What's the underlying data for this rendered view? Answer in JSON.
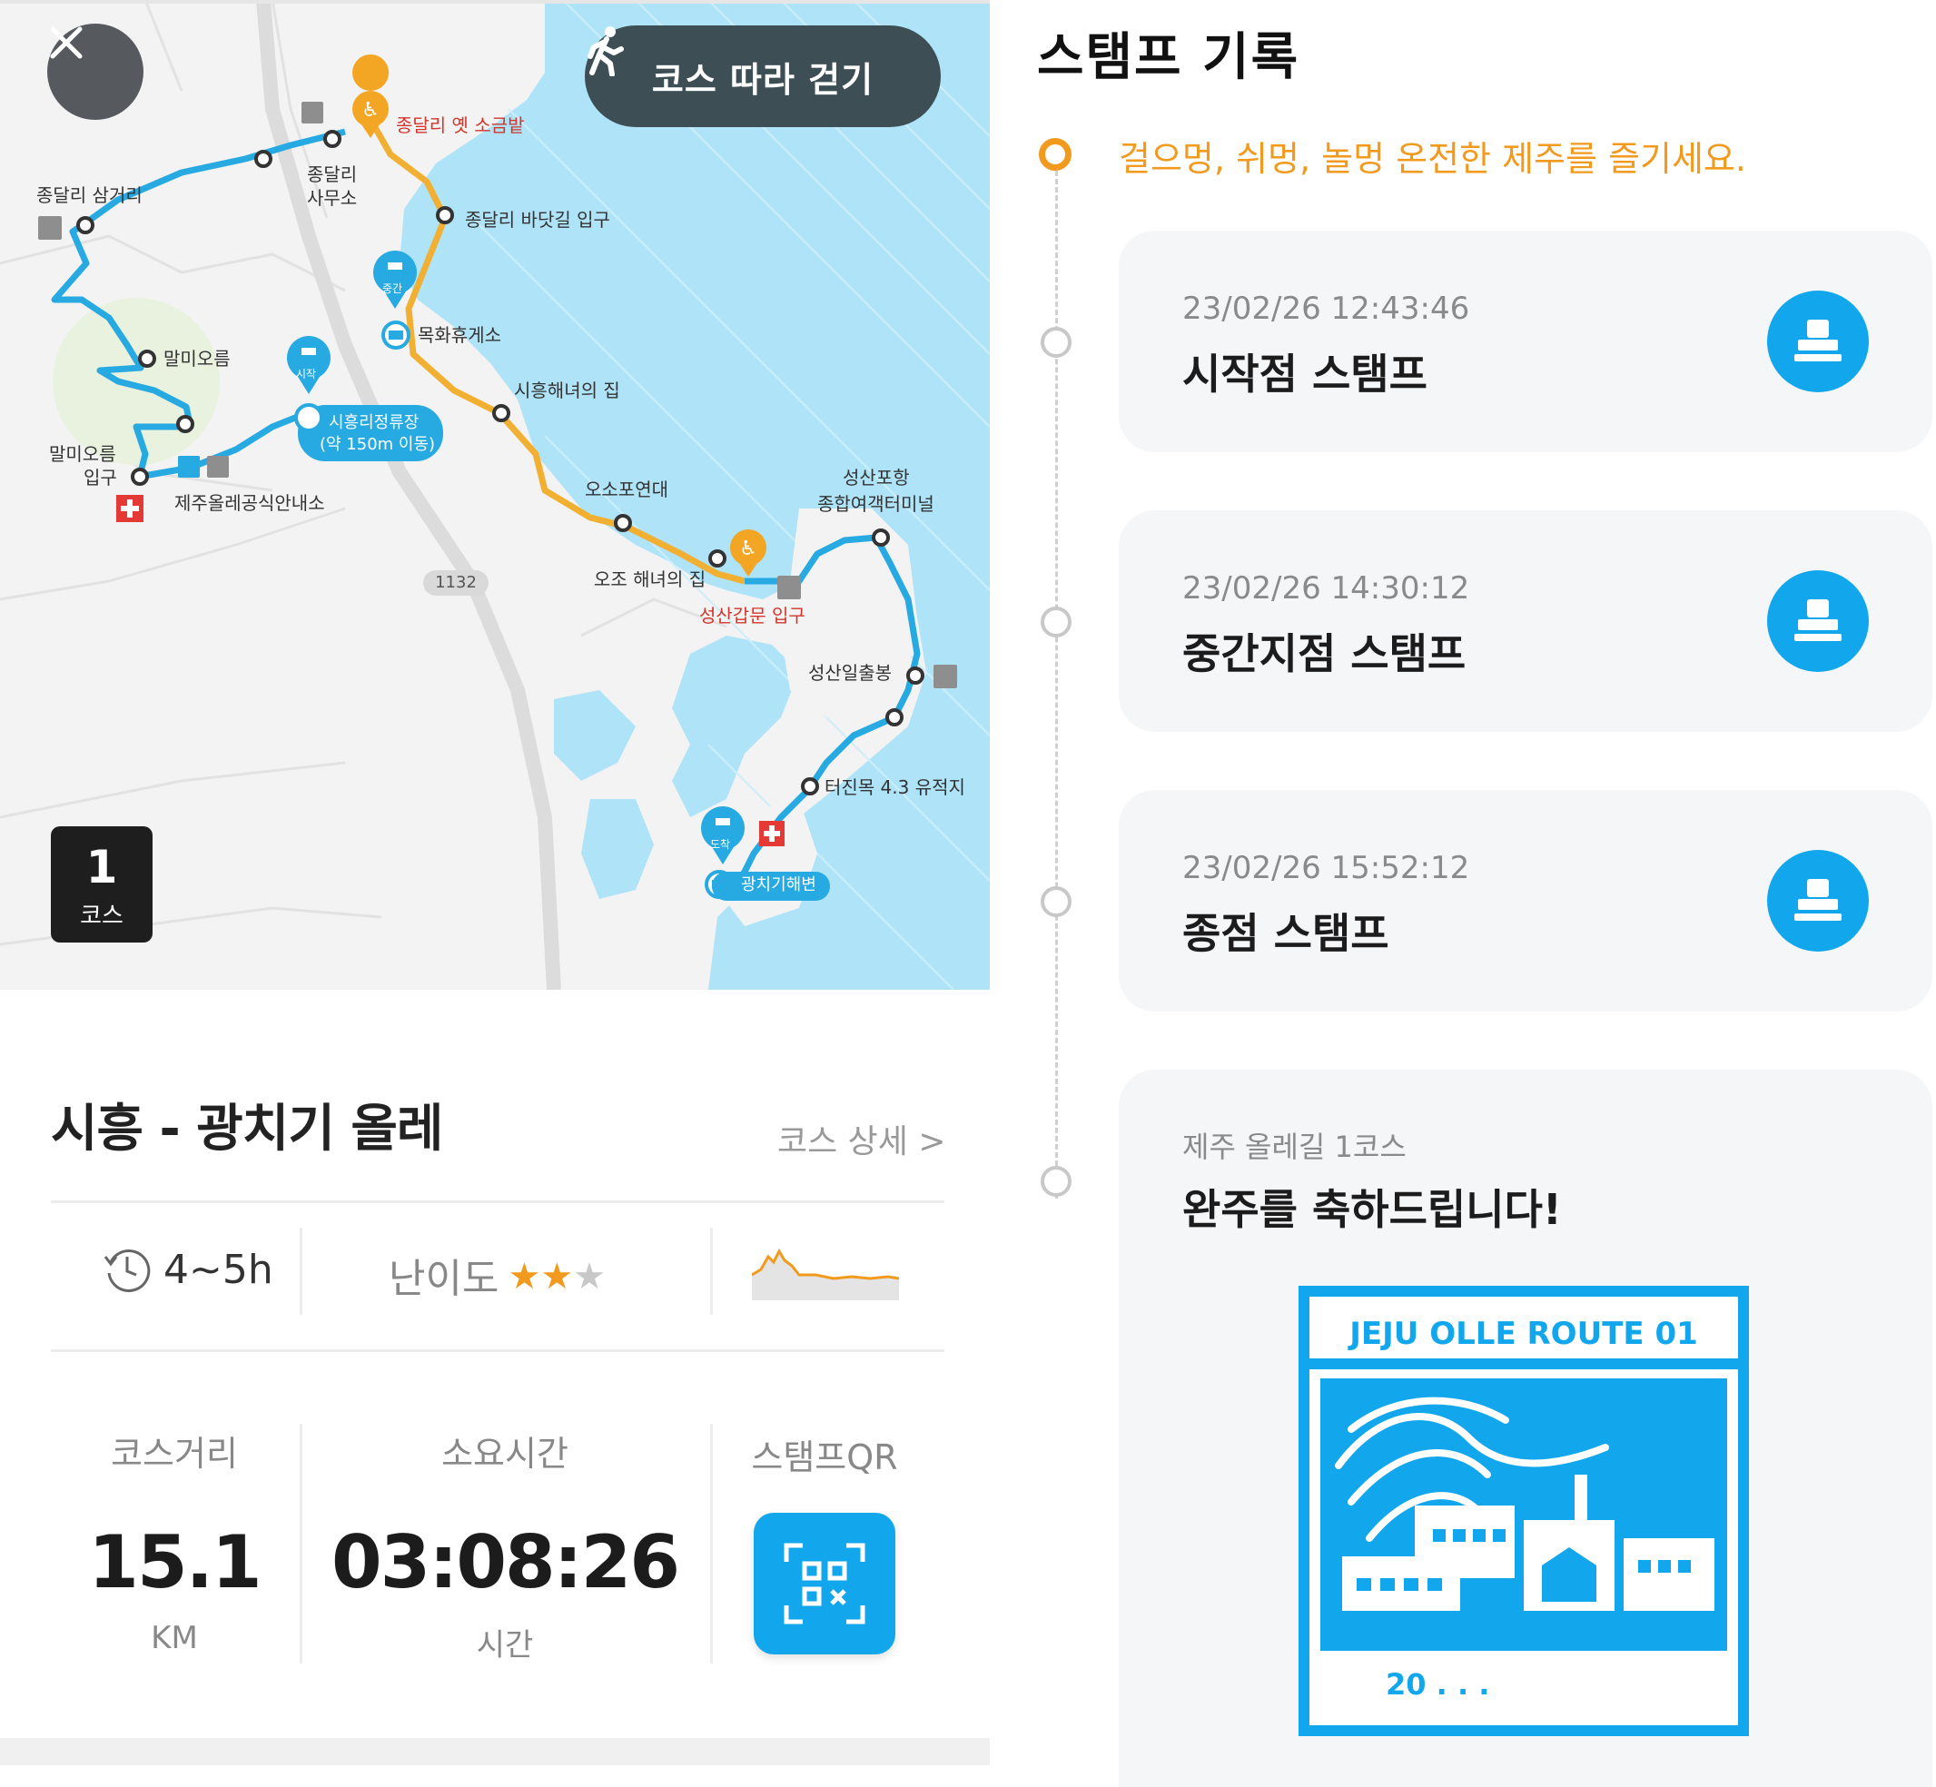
{
  "map": {
    "follow_button": "코스 따라 걷기",
    "course_badge_number": "1",
    "course_badge_label": "코스",
    "road_number": "1132",
    "labels": {
      "jongdal_samgeori": "종달리 삼거리",
      "jongdal_office_1": "종달리",
      "jongdal_office_2": "사무소",
      "jongdal_salt": "종달리 옛 소금밭",
      "jongdal_badang": "종달리 바닷길 입구",
      "mokhwa": "목화휴게소",
      "malmi": "말미오름",
      "malmi_entrance_1": "말미오름",
      "malmi_entrance_2": "입구",
      "siheung_bus_1": "시흥리정류장",
      "siheung_bus_2": "(약 150m 이동)",
      "olle_info": "제주올레공식안내소",
      "siheung_haenyeo": "시흥해녀의 집",
      "osopo": "오소포연대",
      "ojo_haenyeo": "오조 해녀의 집",
      "seongsan_gate": "성산갑문 입구",
      "seongsan_port_1": "성산포항",
      "seongsan_port_2": "종합여객터미널",
      "seongsan_ilchulbong": "성산일출봉",
      "teojinmok": "터진목 4.3 유적지",
      "gwangchigi": "광치기해변",
      "pin_start": "시작",
      "pin_mid": "중간",
      "pin_end": "도착"
    }
  },
  "course": {
    "title": "시흥 - 광치기 올레",
    "detail_link": "코스 상세 >",
    "duration": "4~5h",
    "difficulty_label": "난이도",
    "difficulty_rating": 2,
    "difficulty_max": 3,
    "stats": {
      "distance_label": "코스거리",
      "distance_value": "15.1",
      "distance_unit": "KM",
      "time_label": "소요시간",
      "time_value": "03:08:26",
      "time_unit": "시간",
      "qr_label": "스탬프QR"
    }
  },
  "stamps": {
    "title": "스탬프 기록",
    "tagline": "걸으멍, 쉬멍, 놀멍 온전한 제주를 즐기세요.",
    "records": [
      {
        "time": "23/02/26 12:43:46",
        "name": "시작점 스탬프"
      },
      {
        "time": "23/02/26 14:30:12",
        "name": "중간지점 스탬프"
      },
      {
        "time": "23/02/26 15:52:12",
        "name": "종점 스탬프"
      }
    ],
    "finish": {
      "subtitle": "제주 올레길 1코스",
      "message": "완주를 축하드립니다!",
      "stamp_heading": "JEJU OLLE ROUTE 01",
      "stamp_date": "20  .    .    ."
    }
  },
  "colors": {
    "accent_blue": "#12a7ec",
    "accent_orange": "#f29a1e",
    "sea": "#aee3f8"
  }
}
